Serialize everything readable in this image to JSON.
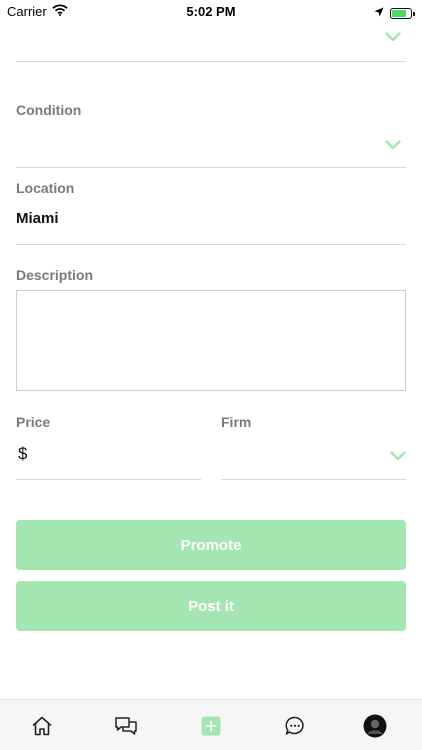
{
  "status_bar": {
    "carrier": "Carrier",
    "time": "5:02 PM"
  },
  "form": {
    "condition": {
      "label": "Condition",
      "value": ""
    },
    "location": {
      "label": "Location",
      "value": "Miami"
    },
    "description": {
      "label": "Description",
      "value": ""
    },
    "price": {
      "label": "Price",
      "currency": "$",
      "value": ""
    },
    "firm": {
      "label": "Firm",
      "value": ""
    }
  },
  "buttons": {
    "promote": "Promote",
    "post": "Post it"
  },
  "tab_bar": {
    "items": [
      {
        "icon": "home-icon"
      },
      {
        "icon": "chat-bubbles-icon"
      },
      {
        "icon": "add-icon"
      },
      {
        "icon": "message-icon"
      },
      {
        "icon": "profile-avatar"
      }
    ]
  },
  "colors": {
    "accent": "#a3e6b1",
    "chevron": "#a3e6b1",
    "label": "#7a7a7a"
  }
}
